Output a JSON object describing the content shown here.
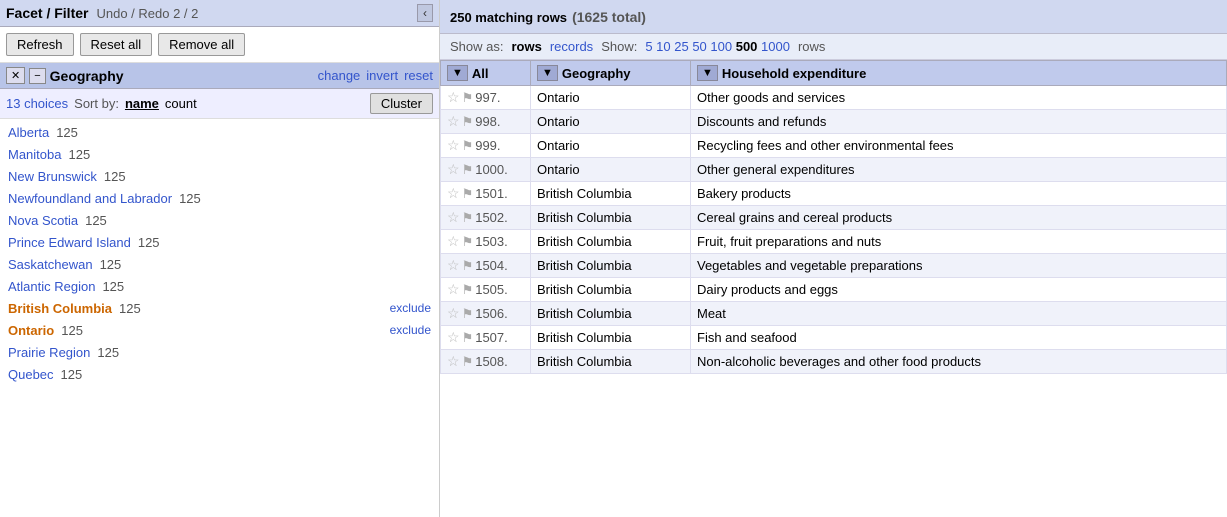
{
  "left": {
    "header": {
      "title": "Facet / Filter",
      "undo_redo": "Undo / Redo 2 / 2",
      "collapse_icon": "‹"
    },
    "buttons": {
      "refresh": "Refresh",
      "reset_all": "Reset all",
      "remove_all": "Remove all"
    },
    "geography": {
      "title": "Geography",
      "x_label": "✕",
      "minus_label": "−",
      "actions": [
        "change",
        "invert",
        "reset"
      ],
      "sort_bar": {
        "choices": "13 choices",
        "sort_by_label": "Sort by:",
        "name_label": "name",
        "count_label": "count",
        "cluster_btn": "Cluster"
      },
      "items": [
        {
          "name": "Alberta",
          "count": "125",
          "orange": false,
          "exclude": false
        },
        {
          "name": "Manitoba",
          "count": "125",
          "orange": false,
          "exclude": false
        },
        {
          "name": "New Brunswick",
          "count": "125",
          "orange": false,
          "exclude": false
        },
        {
          "name": "Newfoundland and Labrador",
          "count": "125",
          "orange": false,
          "exclude": false
        },
        {
          "name": "Nova Scotia",
          "count": "125",
          "orange": false,
          "exclude": false
        },
        {
          "name": "Prince Edward Island",
          "count": "125",
          "orange": false,
          "exclude": false
        },
        {
          "name": "Saskatchewan",
          "count": "125",
          "orange": false,
          "exclude": false
        },
        {
          "name": "Atlantic Region",
          "count": "125",
          "orange": false,
          "exclude": false
        },
        {
          "name": "British Columbia",
          "count": "125",
          "orange": true,
          "exclude": true
        },
        {
          "name": "Ontario",
          "count": "125",
          "orange": true,
          "exclude": true
        },
        {
          "name": "Prairie Region",
          "count": "125",
          "orange": false,
          "exclude": false
        },
        {
          "name": "Quebec",
          "count": "125",
          "orange": false,
          "exclude": false
        }
      ]
    }
  },
  "right": {
    "header": {
      "matching": "250 matching rows",
      "total": "(1625 total)"
    },
    "view_bar": {
      "show_as_label": "Show as:",
      "rows_opt": "rows",
      "records_opt": "records",
      "show_label": "Show:",
      "page_opts": [
        "5",
        "10",
        "25",
        "50",
        "100",
        "500",
        "1000"
      ],
      "active_page": "500",
      "rows_label": "rows"
    },
    "table": {
      "columns": [
        "All",
        "Geography",
        "Household expenditure"
      ],
      "rows": [
        {
          "num": "997.",
          "geo": "Ontario",
          "expenditure": "Other goods and services"
        },
        {
          "num": "998.",
          "geo": "Ontario",
          "expenditure": "Discounts and refunds"
        },
        {
          "num": "999.",
          "geo": "Ontario",
          "expenditure": "Recycling fees and other environmental fees"
        },
        {
          "num": "1000.",
          "geo": "Ontario",
          "expenditure": "Other general expenditures"
        },
        {
          "num": "1501.",
          "geo": "British Columbia",
          "expenditure": "Bakery products"
        },
        {
          "num": "1502.",
          "geo": "British Columbia",
          "expenditure": "Cereal grains and cereal products"
        },
        {
          "num": "1503.",
          "geo": "British Columbia",
          "expenditure": "Fruit, fruit preparations and nuts"
        },
        {
          "num": "1504.",
          "geo": "British Columbia",
          "expenditure": "Vegetables and vegetable preparations"
        },
        {
          "num": "1505.",
          "geo": "British Columbia",
          "expenditure": "Dairy products and eggs"
        },
        {
          "num": "1506.",
          "geo": "British Columbia",
          "expenditure": "Meat"
        },
        {
          "num": "1507.",
          "geo": "British Columbia",
          "expenditure": "Fish and seafood"
        },
        {
          "num": "1508.",
          "geo": "British Columbia",
          "expenditure": "Non-alcoholic beverages and other food products"
        }
      ]
    }
  }
}
